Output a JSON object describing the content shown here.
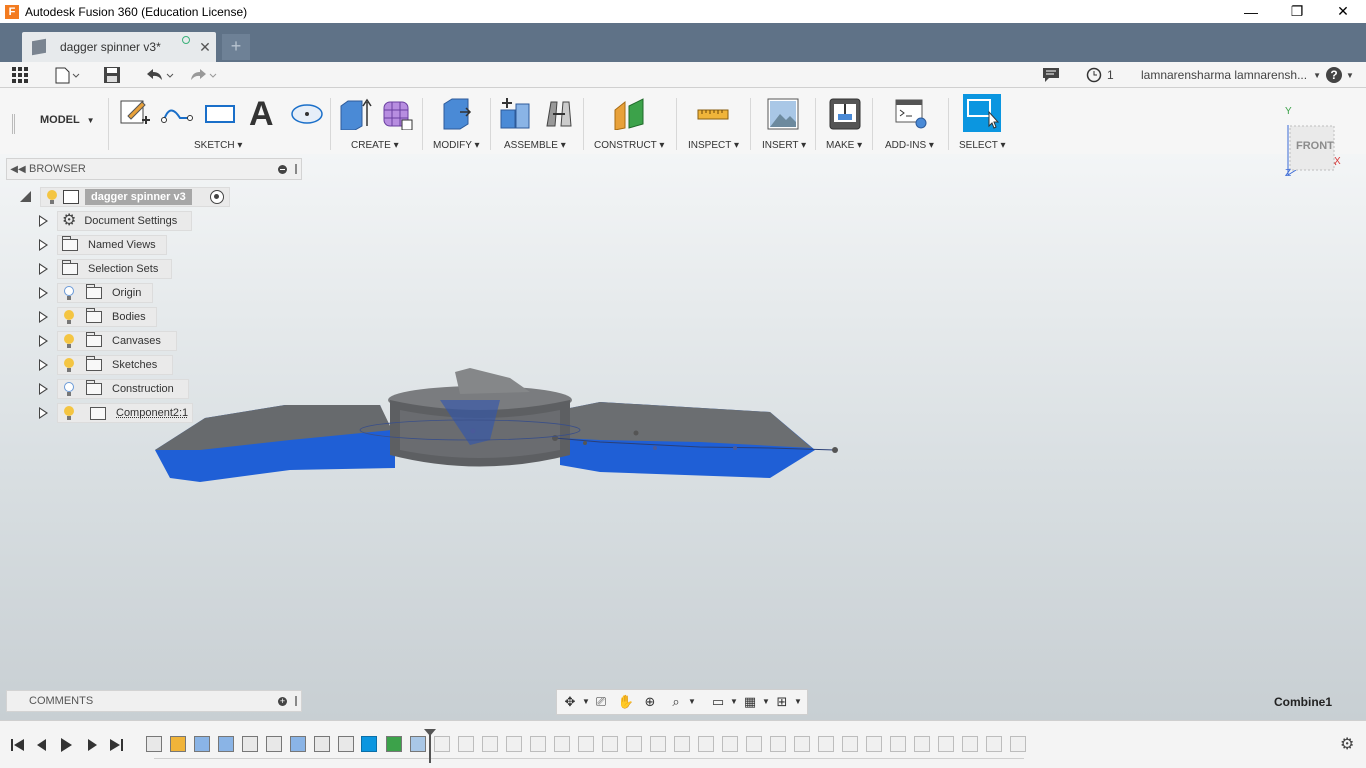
{
  "window": {
    "title": "Autodesk Fusion 360 (Education License)",
    "app_icon": "F",
    "minimize": "—",
    "maximize": "❐",
    "close": "✕"
  },
  "tabs": {
    "active_label": "dagger spinner v3*",
    "close_glyph": "✕",
    "new_tab_glyph": "+"
  },
  "quick_access": {
    "job_count": "1",
    "user": "lamnarensharma lamnarensh...",
    "help": "?"
  },
  "toolbar": {
    "workspace": "MODEL",
    "groups": [
      "SKETCH",
      "CREATE",
      "MODIFY",
      "ASSEMBLE",
      "CONSTRUCT",
      "INSPECT",
      "INSERT",
      "MAKE",
      "ADD-INS",
      "SELECT"
    ],
    "accent": "#0b96e0"
  },
  "viewcube": {
    "face": "FRONT",
    "axis_x": "X",
    "axis_y": "Y",
    "axis_z": "Z"
  },
  "browser": {
    "title": "BROWSER",
    "root": "dagger spinner v3",
    "items": [
      {
        "label": "Document Settings",
        "icon": "gear-icon",
        "bulb": "none"
      },
      {
        "label": "Named Views",
        "icon": "folder-icon",
        "bulb": "none"
      },
      {
        "label": "Selection Sets",
        "icon": "folder-icon",
        "bulb": "none"
      },
      {
        "label": "Origin",
        "icon": "folder-icon",
        "bulb": "off"
      },
      {
        "label": "Bodies",
        "icon": "folder-icon",
        "bulb": "on"
      },
      {
        "label": "Canvases",
        "icon": "folder-icon",
        "bulb": "on"
      },
      {
        "label": "Sketches",
        "icon": "folder-icon",
        "bulb": "on"
      },
      {
        "label": "Construction",
        "icon": "folder-icon",
        "bulb": "off"
      },
      {
        "label": "Component2:1",
        "icon": "component-icon",
        "bulb": "on"
      }
    ]
  },
  "comments": {
    "title": "COMMENTS"
  },
  "status": {
    "current_feature": "Combine1"
  },
  "colors": {
    "titlebar_tab_bg": "#5f7287",
    "body_blue": "#1f5fd6",
    "body_gray": "#6f6f6f"
  }
}
